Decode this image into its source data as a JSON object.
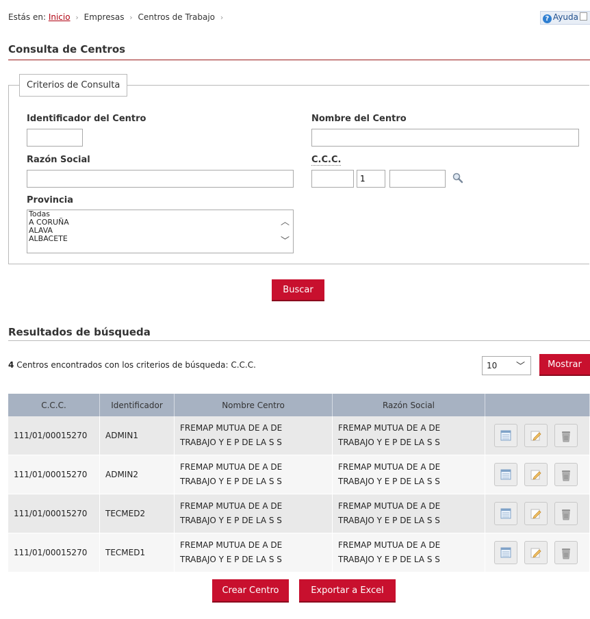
{
  "breadcrumb": {
    "prefix": "Estás en:",
    "home": "Inicio",
    "items": [
      "Empresas",
      "Centros de Trabajo"
    ]
  },
  "help": {
    "label": "Ayuda"
  },
  "page_title": "Consulta de Centros",
  "criteria": {
    "legend": "Criterios de Consulta",
    "id_label": "Identificador del Centro",
    "id_value": "",
    "name_label": "Nombre del Centro",
    "name_value": "",
    "razon_label": "Razón Social",
    "razon_value": "",
    "ccc_label": "C.C.C.",
    "ccc_part1": "",
    "ccc_part2": "1",
    "ccc_part3": "",
    "province_label": "Provincia",
    "province_options": [
      "Todas",
      "A CORUÑA",
      "ALAVA",
      "ALBACETE"
    ]
  },
  "buttons": {
    "search": "Buscar",
    "show": "Mostrar",
    "create": "Crear Centro",
    "export": "Exportar a Excel"
  },
  "results": {
    "title": "Resultados de búsqueda",
    "count": "4",
    "summary": "Centros encontrados con los criterios de búsqueda: C.C.C.",
    "page_size": "10",
    "columns": [
      "C.C.C.",
      "Identificador",
      "Nombre Centro",
      "Razón Social",
      ""
    ],
    "rows": [
      {
        "ccc": "111/01/00015270",
        "id": "ADMIN1",
        "name_l1": "FREMAP MUTUA DE A DE",
        "name_l2": "TRABAJO Y E P DE LA S S",
        "razon_l1": "FREMAP MUTUA DE A DE",
        "razon_l2": "TRABAJO Y E P DE LA S S"
      },
      {
        "ccc": "111/01/00015270",
        "id": "ADMIN2",
        "name_l1": "FREMAP MUTUA DE A DE",
        "name_l2": "TRABAJO Y E P DE LA S S",
        "razon_l1": "FREMAP MUTUA DE A DE",
        "razon_l2": "TRABAJO Y E P DE LA S S"
      },
      {
        "ccc": "111/01/00015270",
        "id": "TECMED2",
        "name_l1": "FREMAP MUTUA DE A DE",
        "name_l2": "TRABAJO Y E P DE LA S S",
        "razon_l1": "FREMAP MUTUA DE A DE",
        "razon_l2": "TRABAJO Y E P DE LA S S"
      },
      {
        "ccc": "111/01/00015270",
        "id": "TECMED1",
        "name_l1": "FREMAP MUTUA DE A DE",
        "name_l2": "TRABAJO Y E P DE LA S S",
        "razon_l1": "FREMAP MUTUA DE A DE",
        "razon_l2": "TRABAJO Y E P DE LA S S"
      }
    ],
    "row_icons": [
      "view-icon",
      "edit-icon",
      "delete-icon"
    ]
  },
  "colors": {
    "accent": "#c8102e",
    "header_bg": "#a7b2c2",
    "rule": "#9a1a1a"
  }
}
